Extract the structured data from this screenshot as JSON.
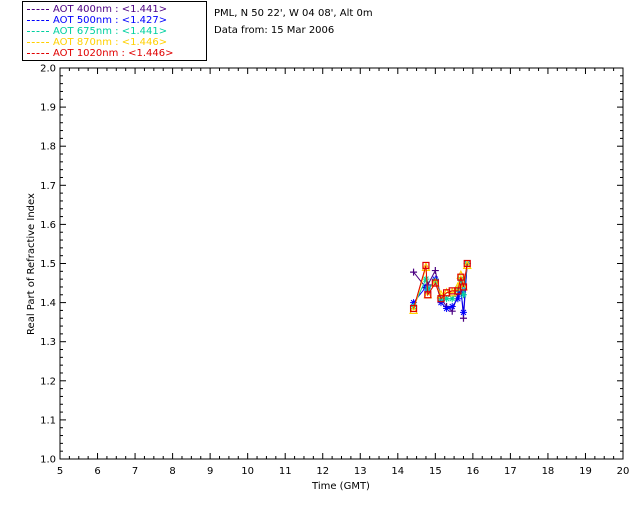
{
  "info": {
    "site": "PML, N 50 22', W 04 08', Alt 0m",
    "data_from": "Data from: 15 Mar 2006"
  },
  "legend": [
    {
      "label": "AOT  400nm : <1.441>",
      "color": "#4b0082"
    },
    {
      "label": "AOT  500nm : <1.427>",
      "color": "#0000ff"
    },
    {
      "label": "AOT  675nm : <1.441>",
      "color": "#00d0a0"
    },
    {
      "label": "AOT  870nm : <1.446>",
      "color": "#ffd000"
    },
    {
      "label": "AOT 1020nm : <1.446>",
      "color": "#e00000"
    }
  ],
  "chart_data": {
    "type": "line",
    "xlabel": "Time (GMT)",
    "ylabel": "Real Part of Refractive Index",
    "xlim": [
      5,
      20
    ],
    "ylim": [
      1.0,
      2.0
    ],
    "xticks": [
      "5",
      "6",
      "7",
      "8",
      "9",
      "10",
      "11",
      "12",
      "13",
      "14",
      "15",
      "16",
      "17",
      "18",
      "19",
      "20"
    ],
    "yticks": [
      "1.0",
      "1.1",
      "1.2",
      "1.3",
      "1.4",
      "1.5",
      "1.6",
      "1.7",
      "1.8",
      "1.9",
      "2.0"
    ],
    "x": [
      14.42,
      14.75,
      14.8,
      15.0,
      15.15,
      15.3,
      15.45,
      15.6,
      15.68,
      15.75,
      15.85
    ],
    "series": [
      {
        "name": "AOT  400nm",
        "color": "#4b0082",
        "marker": "plus",
        "values": [
          1.478,
          1.438,
          1.445,
          1.482,
          1.41,
          1.39,
          1.378,
          1.42,
          1.44,
          1.36,
          1.5
        ]
      },
      {
        "name": "AOT  500nm",
        "color": "#0000ff",
        "marker": "star",
        "values": [
          1.4,
          1.44,
          1.43,
          1.46,
          1.4,
          1.385,
          1.39,
          1.41,
          1.43,
          1.375,
          1.5
        ]
      },
      {
        "name": "AOT  675nm",
        "color": "#00d0a0",
        "marker": "star",
        "values": [
          1.39,
          1.46,
          1.435,
          1.455,
          1.41,
          1.41,
          1.41,
          1.435,
          1.46,
          1.42,
          1.5
        ]
      },
      {
        "name": "AOT  870nm",
        "color": "#ffd000",
        "marker": "triangle",
        "values": [
          1.38,
          1.49,
          1.42,
          1.45,
          1.42,
          1.425,
          1.425,
          1.44,
          1.47,
          1.44,
          1.495
        ]
      },
      {
        "name": "AOT 1020nm",
        "color": "#e00000",
        "marker": "square",
        "values": [
          1.385,
          1.495,
          1.42,
          1.45,
          1.41,
          1.425,
          1.43,
          1.43,
          1.465,
          1.44,
          1.5
        ]
      }
    ]
  }
}
